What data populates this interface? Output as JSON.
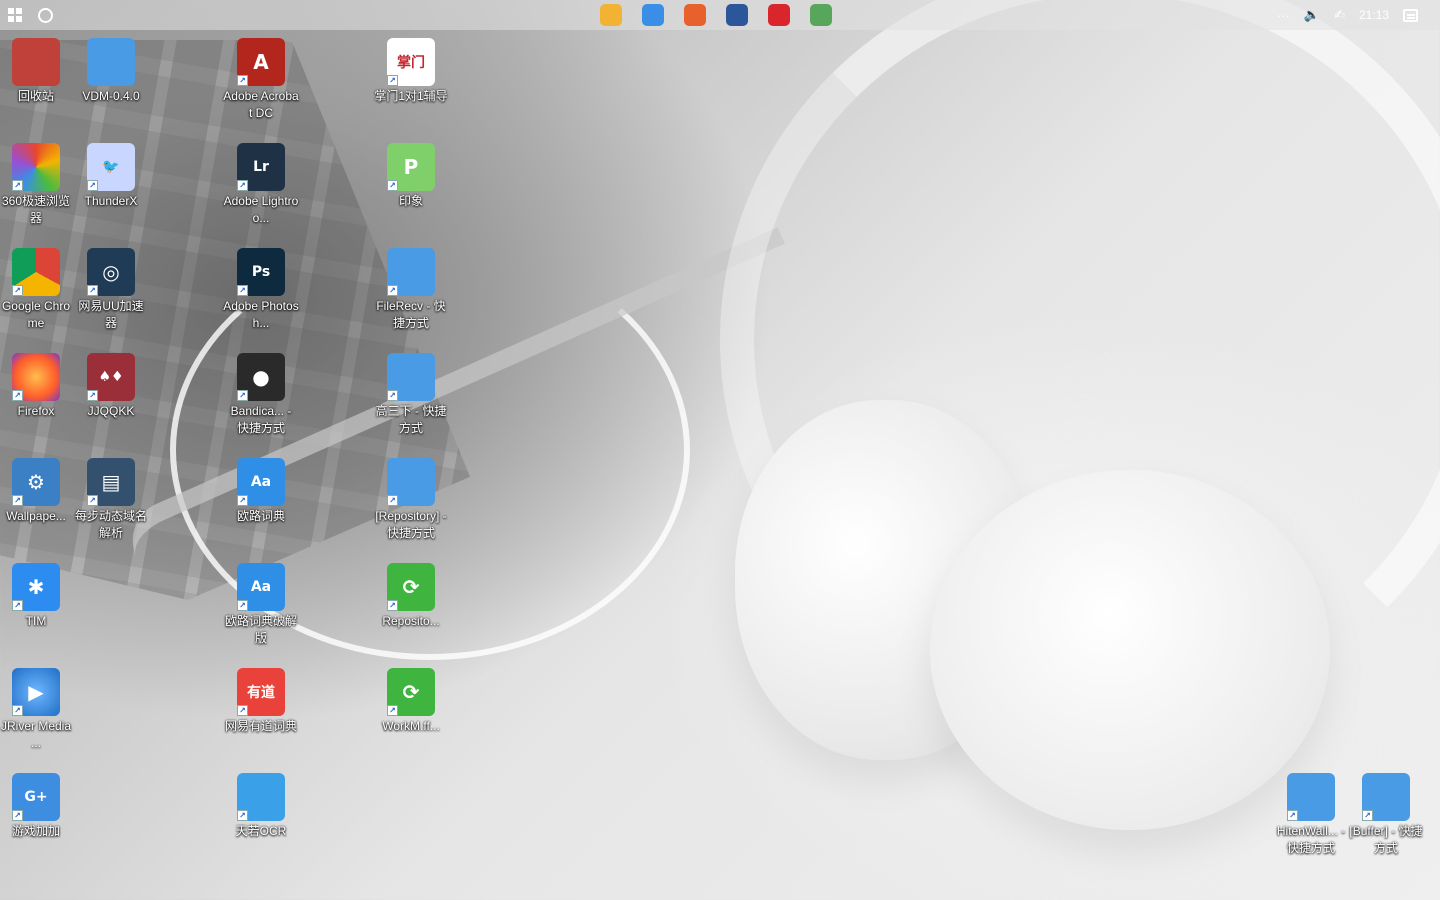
{
  "topbar": {
    "clock": "21:13",
    "tray_more": "···",
    "volume_glyph": "🔈",
    "pen_glyph": "✍",
    "pinned_apps": [
      {
        "name": "file-explorer-icon",
        "color": "#f2b233"
      },
      {
        "name": "360-browser-icon",
        "color": "#3a8ee6"
      },
      {
        "name": "firefox-icon",
        "color": "#e8612c"
      },
      {
        "name": "word-app-icon",
        "color": "#2b579a"
      },
      {
        "name": "red-app-icon",
        "color": "#d8262c"
      },
      {
        "name": "maps-app-icon",
        "color": "#58a55c"
      }
    ]
  },
  "desktop": {
    "icons": [
      {
        "label": "回收站",
        "glyph": "",
        "bg": "#c0403a",
        "icon": "recycle-bin-icon",
        "shortcut": false
      },
      {
        "label": "360极速浏览器",
        "glyph": "",
        "bg": "conic-gradient(#e8462e,#f4b400,#4cbb3f,#3a8ee6,#9b4fd0,#e8462e)",
        "icon": "360-browser-icon",
        "shortcut": true
      },
      {
        "label": "Google Chrome",
        "glyph": "",
        "bg": "conic-gradient(#db4437 0 33%,#f4b400 0 66%,#0f9d58 0)",
        "icon": "chrome-icon",
        "shortcut": true
      },
      {
        "label": "Firefox",
        "glyph": "",
        "bg": "radial-gradient(circle,#ffbd4f,#ff5e2a 60%,#7a37c8)",
        "icon": "firefox-icon",
        "shortcut": true
      },
      {
        "label": "Wallpape...",
        "glyph": "⚙",
        "bg": "#3b7fc4",
        "icon": "wallpaper-app-icon",
        "shortcut": true
      },
      {
        "label": "TIM",
        "glyph": "✱",
        "bg": "#2d8cf0",
        "icon": "tim-icon",
        "shortcut": true
      },
      {
        "label": "JRiver Media ...",
        "glyph": "▶",
        "bg": "radial-gradient(circle,#6fb7ff,#1f6ec6)",
        "icon": "jriver-icon",
        "shortcut": true
      },
      {
        "label": "游戏加加",
        "glyph": "G+",
        "bg": "#3d8de0",
        "icon": "game-plus-icon",
        "shortcut": true
      },
      {
        "label": "VDM-0.4.0",
        "glyph": "",
        "bg": "#4a9be6",
        "icon": "folder-icon",
        "shortcut": false
      },
      {
        "label": "ThunderX",
        "glyph": "🐦",
        "bg": "#c9d6ff",
        "icon": "thunderx-icon",
        "shortcut": true
      },
      {
        "label": "网易UU加速器",
        "glyph": "◎",
        "bg": "#1f3b56",
        "icon": "uu-accelerator-icon",
        "shortcut": true
      },
      {
        "label": "JJQQKK",
        "glyph": "♠♦",
        "bg": "#9a2f3a",
        "icon": "jjqqkk-icon",
        "shortcut": true
      },
      {
        "label": "每步动态域名解析",
        "glyph": "▤",
        "bg": "#33516e",
        "icon": "ddns-icon",
        "shortcut": true
      },
      {
        "label": "Adobe Acrobat DC",
        "glyph": "A",
        "bg": "#b3261e",
        "icon": "acrobat-icon",
        "shortcut": true
      },
      {
        "label": "Adobe Lightroo...",
        "glyph": "Lr",
        "bg": "#1f3245",
        "icon": "lightroom-icon",
        "shortcut": true
      },
      {
        "label": "Adobe Photosh...",
        "glyph": "Ps",
        "bg": "#0d2a3f",
        "icon": "photoshop-icon",
        "shortcut": true
      },
      {
        "label": "Bandica... - 快捷方式",
        "glyph": "●",
        "bg": "#2a2a2a",
        "icon": "bandicam-icon",
        "shortcut": true
      },
      {
        "label": "欧路词典",
        "glyph": "Aa",
        "bg": "#2f8fe6",
        "icon": "eudic-icon",
        "shortcut": true
      },
      {
        "label": "欧路词典破解版",
        "glyph": "Aa",
        "bg": "#2f8fe6",
        "icon": "eudic-cracked-icon",
        "shortcut": true
      },
      {
        "label": "网易有道词典",
        "glyph": "有道",
        "bg": "#e8423b",
        "icon": "youdao-icon",
        "shortcut": true
      },
      {
        "label": "天若OCR",
        "glyph": "",
        "bg": "#3aa0e8",
        "icon": "tianruo-ocr-icon",
        "shortcut": true
      },
      {
        "label": "掌门1对1辅导",
        "glyph": "掌门",
        "bg": "#ffffff",
        "icon": "zhangmen-icon",
        "shortcut": true
      },
      {
        "label": "印象",
        "glyph": "P",
        "bg": "#7fcf6a",
        "icon": "yinxiang-icon",
        "shortcut": true
      },
      {
        "label": "FileRecv - 快捷方式",
        "glyph": "",
        "bg": "#4a9be6",
        "icon": "folder-icon",
        "shortcut": true
      },
      {
        "label": "高三下 - 快捷方式",
        "glyph": "",
        "bg": "#4a9be6",
        "icon": "folder-icon",
        "shortcut": true
      },
      {
        "label": "[Repository] - 快捷方式",
        "glyph": "",
        "bg": "#4a9be6",
        "icon": "folder-icon",
        "shortcut": true
      },
      {
        "label": "Reposito...",
        "glyph": "⟳",
        "bg": "#3fb43f",
        "icon": "sync-icon",
        "shortcut": true
      },
      {
        "label": "WorkM.ff...",
        "glyph": "⟳",
        "bg": "#3fb43f",
        "icon": "sync-icon",
        "shortcut": true
      },
      {
        "label": "HitenWall... - 快捷方式",
        "glyph": "",
        "bg": "#4a9be6",
        "icon": "folder-icon",
        "shortcut": true
      },
      {
        "label": "[Buffer] - 快捷方式",
        "glyph": "",
        "bg": "#4a9be6",
        "icon": "folder-icon",
        "shortcut": true
      }
    ]
  }
}
